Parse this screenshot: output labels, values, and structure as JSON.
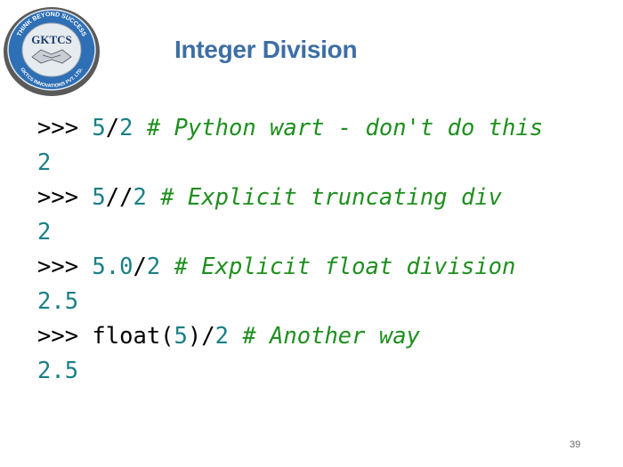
{
  "logo": {
    "name": "GKTCS",
    "top_arc": "THINK BEYOND SUCCESS",
    "bottom_arc": "GKTCS INNOVATIONS PVT. LTD."
  },
  "title": "Integer Division",
  "code": {
    "line1": {
      "prompt": ">>>",
      "num1": "5",
      "op": "/",
      "num2": "2",
      "comment": "# Python wart - don't do this"
    },
    "out1": "2",
    "line2": {
      "prompt": ">>>",
      "num1": "5",
      "op": "//",
      "num2": "2",
      "comment": "# Explicit truncating div"
    },
    "out2": "2",
    "line3": {
      "prompt": ">>>",
      "num1": "5.0",
      "op": "/",
      "num2": "2",
      "comment": "# Explicit float division"
    },
    "out3": "2.5",
    "line4": {
      "prompt": ">>>",
      "fn": "float(",
      "num1": "5",
      "close": ")/",
      "num2": "2",
      "comment": "# Another way"
    },
    "out4": "2.5"
  },
  "page_number": "39",
  "colors": {
    "title": "#3d6ea4",
    "number": "#1a7f86",
    "comment": "#1f8f1f",
    "logo_blue": "#2e6fb5"
  }
}
